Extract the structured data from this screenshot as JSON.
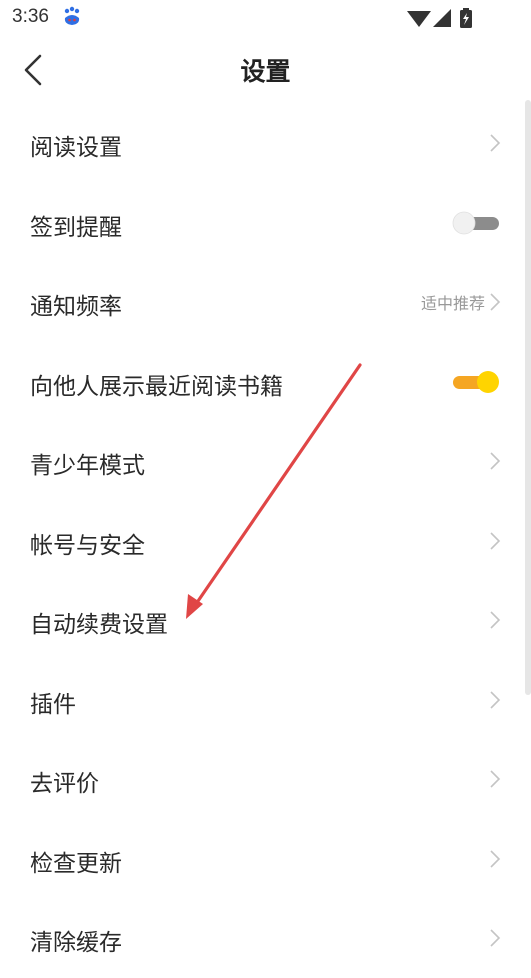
{
  "status": {
    "time": "3:36"
  },
  "header": {
    "title": "设置"
  },
  "settings": [
    {
      "label": "阅读设置"
    },
    {
      "label": "签到提醒"
    },
    {
      "label": "通知频率",
      "value": "适中推荐"
    },
    {
      "label": "向他人展示最近阅读书籍"
    },
    {
      "label": "青少年模式"
    },
    {
      "label": "帐号与安全"
    },
    {
      "label": "自动续费设置"
    },
    {
      "label": "插件"
    },
    {
      "label": "去评价"
    },
    {
      "label": "检查更新"
    },
    {
      "label": "清除缓存"
    }
  ],
  "toggles": {
    "checkin_reminder": "off",
    "show_recent_reading": "on"
  },
  "colors": {
    "toggle_on_track": "#f5a623",
    "toggle_on_knob": "#ffd400",
    "annotation_arrow": "#e04646"
  }
}
